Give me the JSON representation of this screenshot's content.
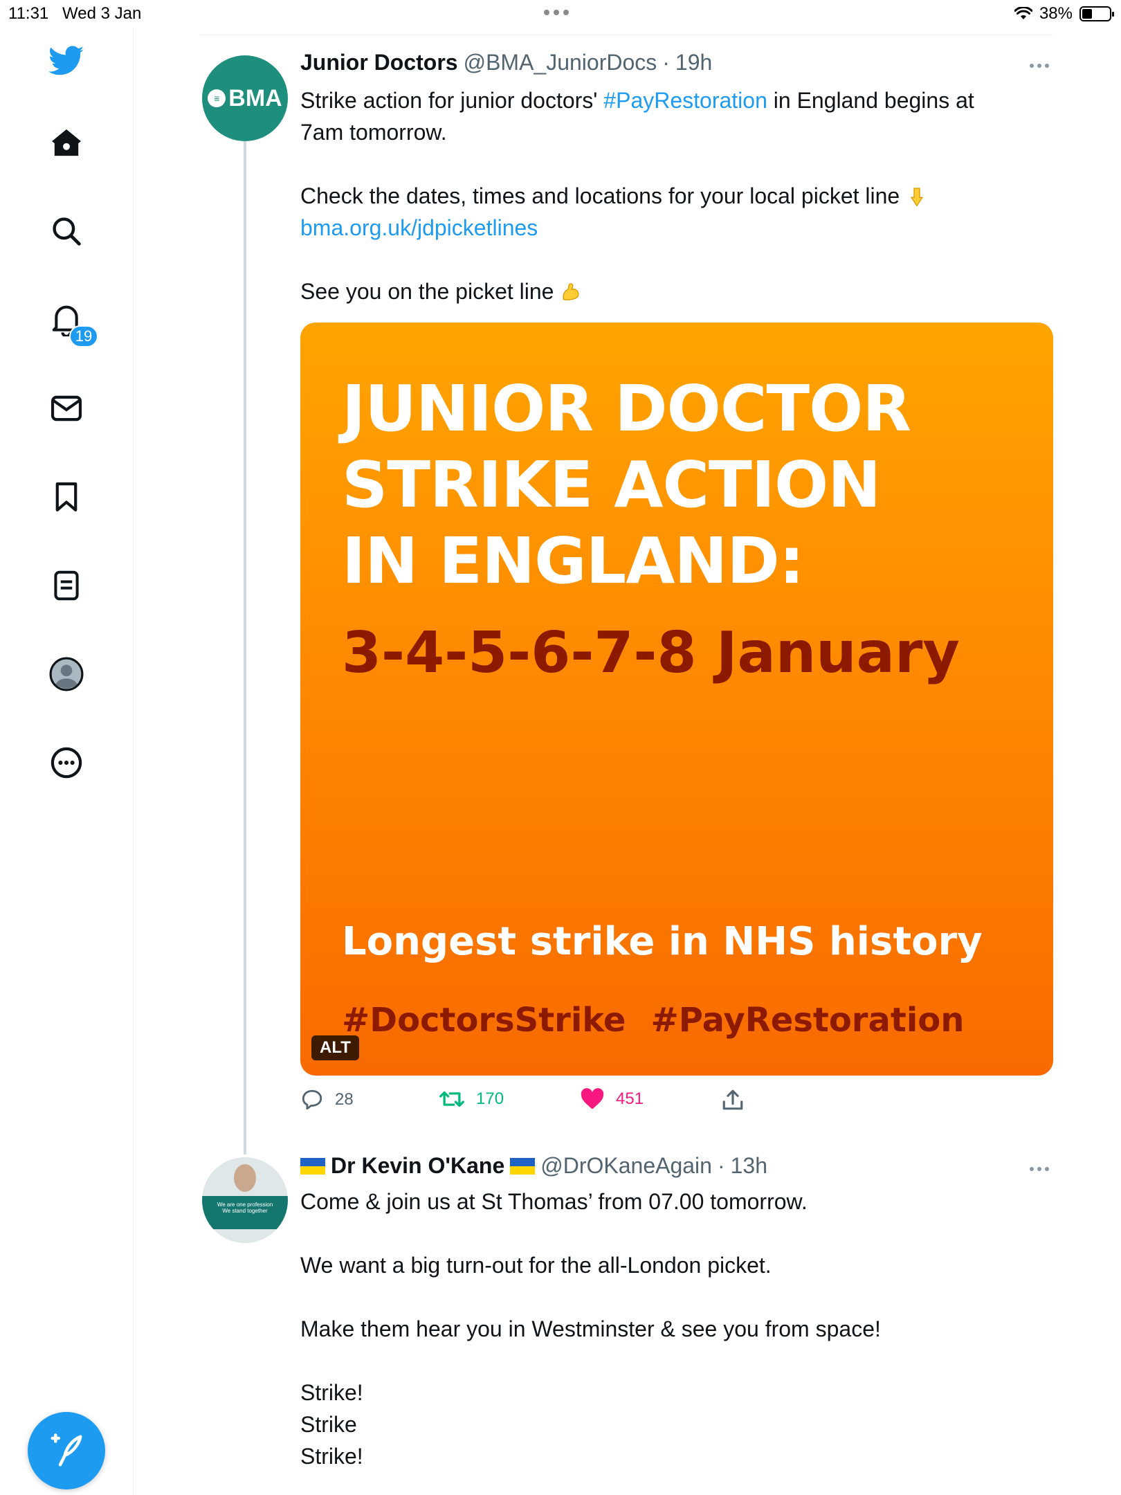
{
  "status_bar": {
    "time": "11:31",
    "date": "Wed 3 Jan",
    "battery": "38%",
    "battery_level": 0.38
  },
  "sidebar": {
    "notifications_badge": "19",
    "items": [
      "home",
      "explore",
      "notifications",
      "messages",
      "bookmarks",
      "lists",
      "profile",
      "more"
    ]
  },
  "tweets": [
    {
      "name": "Junior Doctors",
      "handle": "@BMA_JuniorDocs",
      "sep": "·",
      "time": "19h",
      "avatar_text": "BMA",
      "text_lines": {
        "l1a": "Strike action for junior doctors' ",
        "l1_link": "#PayRestoration",
        "l1b": " in England begins at",
        "l2": "7am tomorrow.",
        "l3": "Check the dates, times and locations for your local picket line ",
        "l4_link": "bma.org.uk/jdpicketlines",
        "l5": "See you on the picket line "
      },
      "image": {
        "line1": "JUNIOR DOCTOR",
        "line2": "STRIKE ACTION",
        "line3": "IN ENGLAND:",
        "dates": "3-4-5-6-7-8 January",
        "subtitle": "Longest strike in NHS history",
        "tag1": "#DoctorsStrike",
        "tag2": "#PayRestoration",
        "alt_badge": "ALT"
      },
      "actions": {
        "replies": "28",
        "retweets": "170",
        "likes": "451"
      },
      "colors": {
        "retweet": "#00ba7c",
        "like": "#f91880"
      }
    },
    {
      "name": "Dr Kevin O'Kane",
      "handle": "@DrOKaneAgain",
      "sep": "·",
      "time": "13h",
      "avatar_board_text": "We are one profession",
      "avatar_board_sub": "We stand together",
      "text_lines": {
        "l1": "Come & join us at St Thomas’ from 07.00 tomorrow.",
        "l2": "We want a big turn-out for the all-London picket.",
        "l3": "Make them hear you in Westminster & see you from space!",
        "l4": "Strike!",
        "l5": "Strike",
        "l6": "Strike!"
      }
    }
  ],
  "colors": {
    "accent": "#1d9bf0",
    "text": "#0f1419",
    "muted": "#536471"
  }
}
